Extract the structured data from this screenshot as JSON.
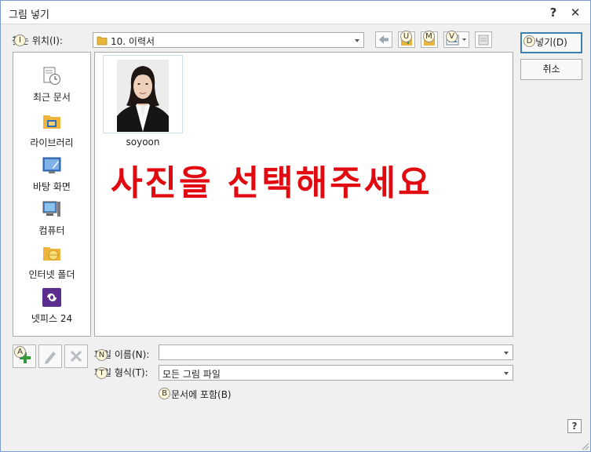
{
  "window": {
    "title": "그림 넣기",
    "help_glyph": "?",
    "close_glyph": "✕"
  },
  "location": {
    "label": "찾는 위치(I):",
    "hint_key": "I",
    "value": "10. 이력서"
  },
  "toolbar": {
    "icons": [
      "back-arrow-icon",
      "up-folder-icon",
      "new-folder-icon",
      "view-menu-icon",
      "properties-icon"
    ],
    "hint_up": "U",
    "hint_new": "M",
    "hint_view": "V"
  },
  "places": {
    "items": [
      {
        "label": "최근 문서",
        "icon": "recent-documents-icon"
      },
      {
        "label": "라이브러리",
        "icon": "library-icon"
      },
      {
        "label": "바탕 화면",
        "icon": "desktop-icon"
      },
      {
        "label": "컴퓨터",
        "icon": "computer-icon"
      },
      {
        "label": "인터넷 폴더",
        "icon": "internet-folder-icon"
      },
      {
        "label": "넷피스 24",
        "icon": "netffice-icon"
      }
    ]
  },
  "files": {
    "items": [
      {
        "name": "soyoon"
      }
    ]
  },
  "overlay": {
    "text": "사진을 선택해주세요",
    "color": "#e00a10"
  },
  "buttons": {
    "insert_label": "넣기(D)",
    "insert_hint": "D",
    "cancel_label": "취소",
    "corner_help": "?"
  },
  "place_tools": {
    "add_hint": "A"
  },
  "filename": {
    "label": "파일 이름(N):",
    "hint_key": "N",
    "value": ""
  },
  "filetype": {
    "label": "파일 형식(T):",
    "hint_key": "T",
    "value": "모든 그림 파일"
  },
  "embed": {
    "label": "문서에 포함(B)",
    "hint_key": "B"
  }
}
